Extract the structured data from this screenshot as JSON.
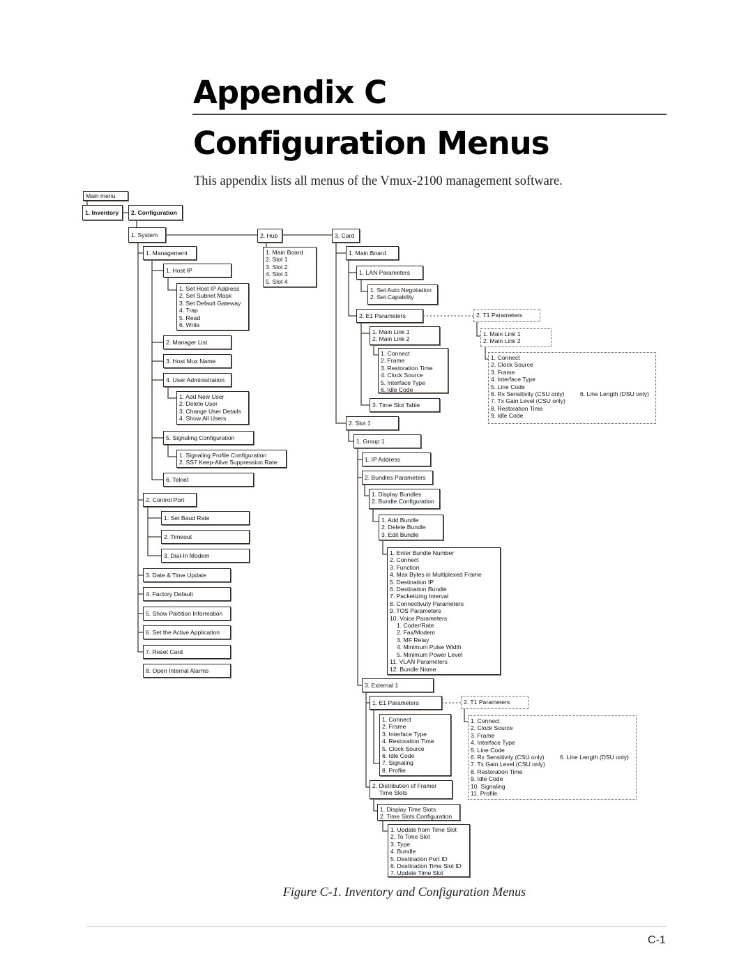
{
  "header": {
    "title_line1": "Appendix C",
    "title_line2": "Configuration Menus",
    "intro": "This appendix lists all menus of the Vmux-2100 management software."
  },
  "figure": {
    "caption": "Figure C-1.  Inventory and Configuration Menus",
    "line_color": "#4a3b33",
    "nodes": {
      "main_menu": [
        "Main menu"
      ],
      "inventory": [
        "1. Inventory"
      ],
      "configuration": [
        "2. Configuration"
      ],
      "system": [
        "1. System"
      ],
      "hub": [
        "2. Hub"
      ],
      "card": [
        "3. Card"
      ],
      "hub_items": [
        "1. Main Board",
        "2. Slot 1",
        "3. Slot 2",
        "4. Slot 3",
        "5. Slot 4"
      ],
      "management": [
        "1. Management"
      ],
      "host_ip": [
        "1. Host IP"
      ],
      "host_ip_items": [
        "1. Set Host IP Address",
        "2. Set Subnet Mask",
        "3. Set Default Gateway",
        "4. Trap",
        "5. Read",
        "6. Write"
      ],
      "manager_list": [
        "2. Manager List"
      ],
      "host_mux_name": [
        "3. Host Mux Name"
      ],
      "user_admin": [
        "4. User Administration"
      ],
      "user_admin_items": [
        "1. Add New User",
        "2. Delete User",
        "3. Change User Details",
        "4. Show All Users"
      ],
      "signaling_config": [
        "5. Signaling Configuration"
      ],
      "signaling_items": [
        "1. Signaling Profile Configuration",
        "2. SS7 Keep-Alive Suppression Rate"
      ],
      "telnet": [
        "6. Telnet"
      ],
      "control_port": [
        "2. Control Port"
      ],
      "baud_rate": [
        "1. Set Baud Rate"
      ],
      "timeout": [
        "2. Timeout"
      ],
      "dialin_modem": [
        "3. Dial-In Modem"
      ],
      "date_time": [
        "3. Date & Time Update"
      ],
      "factory_default": [
        "4. Factory Default"
      ],
      "partition_info": [
        "5. Show Partition Information"
      ],
      "active_app": [
        "6. Set the Active Application"
      ],
      "reset_card": [
        "7. Reset Card"
      ],
      "internal_alarms": [
        "8. Open Internal Alarms"
      ],
      "card_main_board": [
        "1. Main Board"
      ],
      "lan_params": [
        "1. LAN Parameters"
      ],
      "lan_items": [
        "1. Set Auto Negotiation",
        "2. Set Capability"
      ],
      "e1_params": [
        "2. E1 Parameters"
      ],
      "main_links": [
        "1. Main Link 1",
        "2. Main Link 2"
      ],
      "e1_link_items": [
        "1. Connect",
        "2. Frame",
        "3. Restoration Time",
        "4. Clock Source",
        "5. Interface Type",
        "6. Idle Code"
      ],
      "time_slot_table": [
        "3. Time Slot Table"
      ],
      "t1_params": [
        "2. T1 Parameters"
      ],
      "t1_main_links": [
        "1. Main Link 1",
        "2. Main Link 2"
      ],
      "t1_link_items": [
        "1. Connect",
        "2. Clock Source",
        "3. Frame",
        "4. Interface Type",
        "5. Line Code",
        "6. Rx Sensitivity (CSU only)",
        "7. Tx Gain Level (CSU only)",
        "8. Restoration Time",
        "9. Idle Code"
      ],
      "t1_link_alt": "6. Line Length (DSU only)",
      "slot1": [
        "2. Slot 1"
      ],
      "group1": [
        "1. Group 1"
      ],
      "ip_address": [
        "1. IP Address"
      ],
      "bundles_params": [
        "2. Bundles Parameters"
      ],
      "bundles_items": [
        "1. Display Bundles",
        "2. Bundle Configuration"
      ],
      "bundle_config_items": [
        "1. Add Bundle",
        "2. Delete Bundle",
        "3. Edit Bundle"
      ],
      "edit_bundle_items": [
        "1. Enter Bundle Number",
        "2. Connect",
        "3. Function",
        "4. Max Bytes in Multiplexed Frame",
        "5. Destination IP",
        "6. Destination Bundle",
        "7. Packetizing Interval",
        "8. Connectivuty Parameters",
        "9. TOS Parameters",
        "10. Voice Parameters",
        "  1. Coder/Rate",
        "  2. Fax/Modem",
        "  3. MF Relay",
        "  4. Minimum Pulse Width",
        "  5. Minimum Power Level",
        "11. VLAN Parameters",
        "12. Bundle Name"
      ],
      "external1": [
        "3. External 1"
      ],
      "ext_e1_params": [
        "1. E1 Parameters"
      ],
      "ext_e1_items": [
        "1. Connect",
        "2. Frame",
        "3. Interface Type",
        "4. Restoration Time",
        "5. Clock Source",
        "6. Idle Code",
        "7. Signaling",
        "8. Profile"
      ],
      "ext_t1_params": [
        "2. T1 Parameters"
      ],
      "ext_t1_items": [
        "1. Connect",
        "2. Clock Source",
        "3. Frame",
        "4. Interface Type",
        "5. Line Code",
        "6. Rx Sensitivity (CSU only)",
        "7. Tx Gain Level (CSU only)",
        "8. Restoration Time",
        "9. Idle Code",
        "10. Signaling",
        "11. Profile"
      ],
      "ext_t1_alt": "6. Line Length (DSU only)",
      "framer_slots": [
        "2. Distribution of Framer",
        "   Time Slots"
      ],
      "framer_items": [
        "1. Display Time Slots",
        "2. Time Slots Configuration"
      ],
      "time_slot_config_items": [
        "1. Update from Time Slot",
        "2. To Time Slot",
        "3. Type",
        "4. Bundle",
        "5. Destination Port ID",
        "6. Destination Time Slot ID",
        "7. Update Time Slot"
      ]
    }
  },
  "footer": {
    "page_number": "C-1"
  }
}
